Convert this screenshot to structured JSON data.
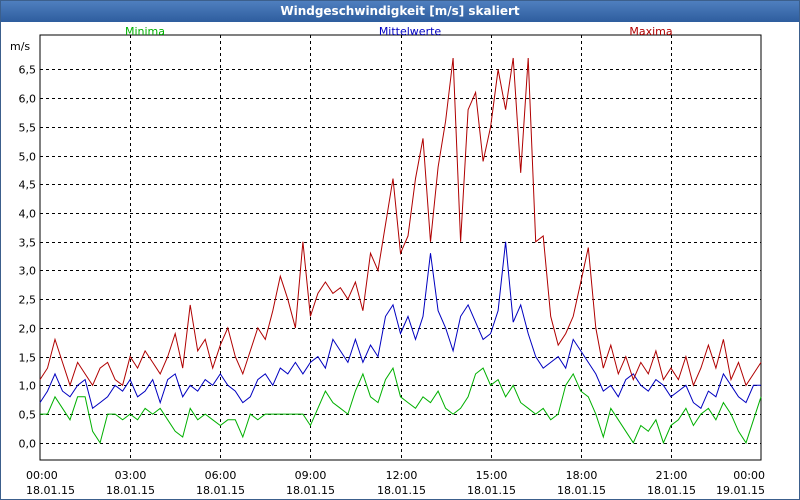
{
  "window": {
    "title": "Windgeschwindigkeit [m/s] skaliert"
  },
  "chart_data": {
    "type": "line",
    "title": "Windgeschwindigkeit [m/s] skaliert",
    "ylabel": "m/s",
    "xlabel": "",
    "ylim": [
      -0.3,
      7.1
    ],
    "xlim": [
      0,
      24
    ],
    "grid": true,
    "legend_placement": "top",
    "y_ticks": [
      "0,0",
      "0,5",
      "1,0",
      "1,5",
      "2,0",
      "2,5",
      "3,0",
      "3,5",
      "4,0",
      "4,5",
      "5,0",
      "5,5",
      "6,0",
      "6,5"
    ],
    "y_tick_values": [
      0,
      0.5,
      1,
      1.5,
      2,
      2.5,
      3,
      3.5,
      4,
      4.5,
      5,
      5.5,
      6,
      6.5
    ],
    "x_ticks": [
      {
        "time": "00:00",
        "date": "18.01.15"
      },
      {
        "time": "03:00",
        "date": "18.01.15"
      },
      {
        "time": "06:00",
        "date": "18.01.15"
      },
      {
        "time": "09:00",
        "date": "18.01.15"
      },
      {
        "time": "12:00",
        "date": "18.01.15"
      },
      {
        "time": "15:00",
        "date": "18.01.15"
      },
      {
        "time": "18:00",
        "date": "18.01.15"
      },
      {
        "time": "21:00",
        "date": "18.01.15"
      },
      {
        "time": "00:00",
        "date": "19.01.15"
      }
    ],
    "x_tick_hours": [
      0,
      3,
      6,
      9,
      12,
      15,
      18,
      21,
      24
    ],
    "x_hours": [
      0,
      0.25,
      0.5,
      0.75,
      1,
      1.25,
      1.5,
      1.75,
      2,
      2.25,
      2.5,
      2.75,
      3,
      3.25,
      3.5,
      3.75,
      4,
      4.25,
      4.5,
      4.75,
      5,
      5.25,
      5.5,
      5.75,
      6,
      6.25,
      6.5,
      6.75,
      7,
      7.25,
      7.5,
      7.75,
      8,
      8.25,
      8.5,
      8.75,
      9,
      9.25,
      9.5,
      9.75,
      10,
      10.25,
      10.5,
      10.75,
      11,
      11.25,
      11.5,
      11.75,
      12,
      12.25,
      12.5,
      12.75,
      13,
      13.25,
      13.5,
      13.75,
      14,
      14.25,
      14.5,
      14.75,
      15,
      15.25,
      15.5,
      15.75,
      16,
      16.25,
      16.5,
      16.75,
      17,
      17.25,
      17.5,
      17.75,
      18,
      18.25,
      18.5,
      18.75,
      19,
      19.25,
      19.5,
      19.75,
      20,
      20.25,
      20.5,
      20.75,
      21,
      21.25,
      21.5,
      21.75,
      22,
      22.25,
      22.5,
      22.75,
      23,
      23.25,
      23.5,
      23.75,
      24
    ],
    "series": [
      {
        "name": "Minima",
        "color": "#00b000",
        "values": [
          0.5,
          0.5,
          0.8,
          0.6,
          0.4,
          0.8,
          0.8,
          0.2,
          0.0,
          0.5,
          0.5,
          0.4,
          0.5,
          0.4,
          0.6,
          0.5,
          0.6,
          0.4,
          0.2,
          0.1,
          0.6,
          0.4,
          0.5,
          0.4,
          0.3,
          0.4,
          0.4,
          0.1,
          0.5,
          0.4,
          0.5,
          0.5,
          0.5,
          0.5,
          0.5,
          0.5,
          0.3,
          0.6,
          0.9,
          0.7,
          0.6,
          0.5,
          0.9,
          1.2,
          0.8,
          0.7,
          1.1,
          1.3,
          0.8,
          0.7,
          0.6,
          0.8,
          0.7,
          0.9,
          0.6,
          0.5,
          0.6,
          0.8,
          1.2,
          1.3,
          1.0,
          1.1,
          0.8,
          1.0,
          0.7,
          0.6,
          0.5,
          0.6,
          0.4,
          0.5,
          1.0,
          1.2,
          0.9,
          0.8,
          0.5,
          0.1,
          0.6,
          0.4,
          0.2,
          0.0,
          0.3,
          0.2,
          0.4,
          0.0,
          0.3,
          0.4,
          0.6,
          0.3,
          0.5,
          0.6,
          0.4,
          0.7,
          0.5,
          0.2,
          0.0,
          0.4,
          0.8
        ]
      },
      {
        "name": "Mittelwerte",
        "color": "#0000c0",
        "values": [
          0.7,
          0.9,
          1.2,
          0.9,
          0.8,
          1.0,
          1.1,
          0.6,
          0.7,
          0.8,
          1.0,
          0.9,
          1.1,
          0.8,
          0.9,
          1.1,
          0.7,
          1.1,
          1.2,
          0.8,
          1.0,
          0.9,
          1.1,
          1.0,
          1.2,
          1.0,
          0.9,
          0.7,
          0.8,
          1.1,
          1.2,
          1.0,
          1.3,
          1.2,
          1.4,
          1.2,
          1.4,
          1.5,
          1.3,
          1.8,
          1.6,
          1.4,
          1.8,
          1.4,
          1.7,
          1.5,
          2.2,
          2.4,
          1.9,
          2.2,
          1.8,
          2.2,
          3.3,
          2.3,
          2.0,
          1.6,
          2.2,
          2.4,
          2.1,
          1.8,
          1.9,
          2.3,
          3.5,
          2.1,
          2.4,
          1.9,
          1.5,
          1.3,
          1.4,
          1.5,
          1.3,
          1.8,
          1.6,
          1.4,
          1.2,
          0.9,
          1.0,
          0.8,
          1.1,
          1.2,
          1.0,
          0.9,
          1.1,
          1.0,
          0.8,
          0.9,
          1.0,
          0.7,
          0.6,
          0.9,
          0.8,
          1.2,
          1.0,
          0.8,
          0.7,
          1.0,
          1.0
        ]
      },
      {
        "name": "Maxima",
        "color": "#b00000",
        "values": [
          1.1,
          1.3,
          1.8,
          1.4,
          1.0,
          1.4,
          1.2,
          1.0,
          1.3,
          1.4,
          1.1,
          1.0,
          1.5,
          1.3,
          1.6,
          1.4,
          1.2,
          1.5,
          1.9,
          1.3,
          2.4,
          1.6,
          1.8,
          1.3,
          1.7,
          2.0,
          1.5,
          1.2,
          1.6,
          2.0,
          1.8,
          2.3,
          2.9,
          2.5,
          2.0,
          3.5,
          2.2,
          2.6,
          2.8,
          2.6,
          2.7,
          2.5,
          2.8,
          2.3,
          3.3,
          3.0,
          3.8,
          4.6,
          3.3,
          3.6,
          4.6,
          5.3,
          3.5,
          4.8,
          5.6,
          6.7,
          3.5,
          5.8,
          6.1,
          4.9,
          5.5,
          6.5,
          5.8,
          6.7,
          4.7,
          6.7,
          3.5,
          3.6,
          2.2,
          1.7,
          1.9,
          2.2,
          2.8,
          3.4,
          2.0,
          1.3,
          1.7,
          1.2,
          1.5,
          1.1,
          1.4,
          1.2,
          1.6,
          1.1,
          1.3,
          1.1,
          1.5,
          1.0,
          1.3,
          1.7,
          1.3,
          1.8,
          1.1,
          1.4,
          1.0,
          1.2,
          1.4
        ]
      }
    ]
  }
}
